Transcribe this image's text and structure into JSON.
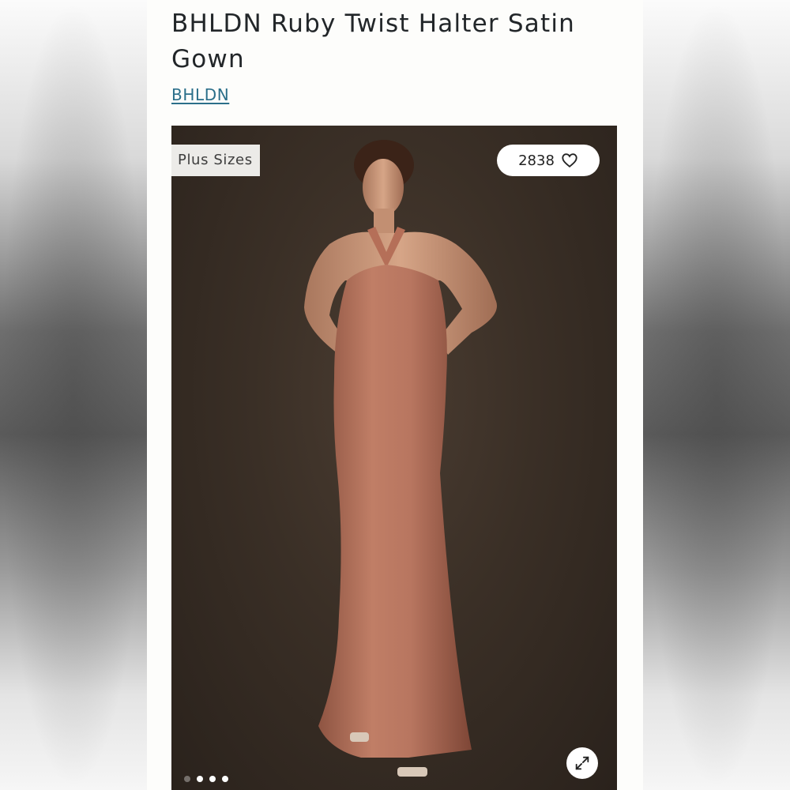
{
  "product": {
    "title": "BHLDN Ruby Twist Halter Satin Gown",
    "brand": "BHLDN"
  },
  "gallery": {
    "badge": "Plus Sizes",
    "likes": "2838",
    "image_count": 4,
    "active_index": 0
  },
  "icons": {
    "like": "heart-icon",
    "expand": "expand-icon"
  },
  "colors": {
    "link": "#2b6f8a",
    "gown": "#b0705a",
    "backdrop": "#3a2f26"
  }
}
